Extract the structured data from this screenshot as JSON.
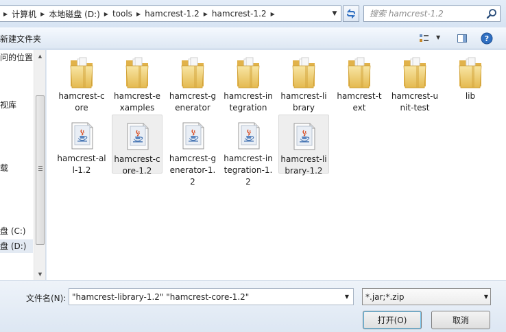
{
  "breadcrumbs": [
    "计算机",
    "本地磁盘 (D:)",
    "tools",
    "hamcrest-1.2",
    "hamcrest-1.2"
  ],
  "search": {
    "placeholder": "搜索 hamcrest-1.2"
  },
  "toolbar": {
    "new_folder": "新建文件夹"
  },
  "nav": {
    "items": [
      {
        "label": "问的位置",
        "selected": false
      },
      {
        "label": "视库",
        "selected": false
      },
      {
        "label": "载",
        "selected": false
      },
      {
        "label": "盘 (C:)",
        "selected": false
      },
      {
        "label": "盘 (D:)",
        "selected": true
      }
    ]
  },
  "files": [
    {
      "name": "hamcrest-core",
      "type": "folder",
      "selected": false
    },
    {
      "name": "hamcrest-examples",
      "type": "folder",
      "selected": false
    },
    {
      "name": "hamcrest-generator",
      "type": "folder",
      "selected": false
    },
    {
      "name": "hamcrest-integration",
      "type": "folder",
      "selected": false
    },
    {
      "name": "hamcrest-library",
      "type": "folder",
      "selected": false
    },
    {
      "name": "hamcrest-text",
      "type": "folder",
      "selected": false
    },
    {
      "name": "hamcrest-unit-test",
      "type": "folder",
      "selected": false
    },
    {
      "name": "lib",
      "type": "folder",
      "selected": false
    },
    {
      "name": "hamcrest-all-1.2",
      "type": "jar",
      "selected": false
    },
    {
      "name": "hamcrest-core-1.2",
      "type": "jar",
      "selected": true
    },
    {
      "name": "hamcrest-generator-1.2",
      "type": "jar",
      "selected": false
    },
    {
      "name": "hamcrest-integration-1.2",
      "type": "jar",
      "selected": false
    },
    {
      "name": "hamcrest-library-1.2",
      "type": "jar",
      "selected": true
    }
  ],
  "filename": {
    "label": "文件名(N):",
    "value": "\"hamcrest-library-1.2\" \"hamcrest-core-1.2\""
  },
  "filetype": {
    "value": "*.jar;*.zip"
  },
  "buttons": {
    "open": "打开(O)",
    "cancel": "取消"
  },
  "colors": {
    "folder": "#f2d27a",
    "selection": "#eeeeee",
    "accent": "#2f6fc1"
  }
}
